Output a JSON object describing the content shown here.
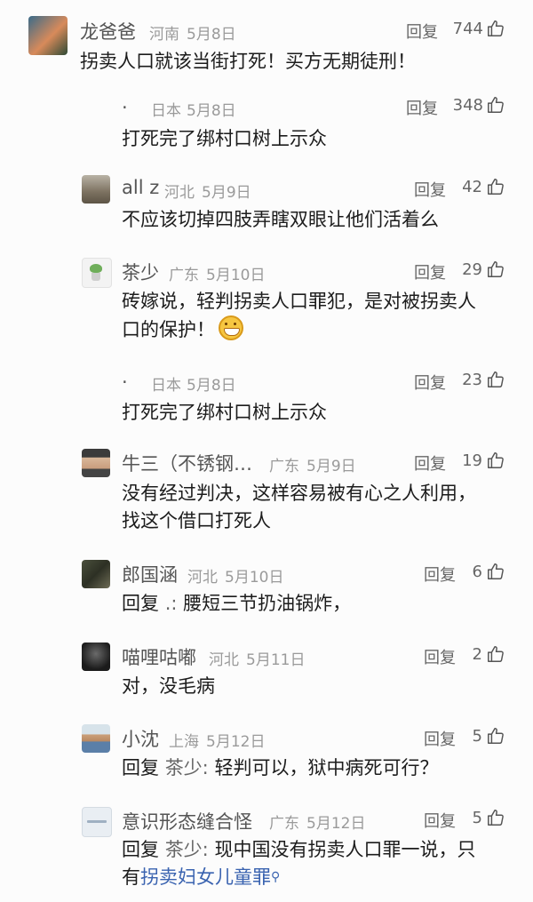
{
  "reply_label": "回复",
  "comments": [
    {
      "name": "龙爸爸",
      "location": "河南",
      "date": "5月8日",
      "likes": "744",
      "text": "拐卖人口就该当街打死！买方无期徒刑！"
    },
    {
      "name": ".",
      "location": "日本",
      "date": "5月8日",
      "likes": "348",
      "text": "打死完了绑村口树上示众"
    },
    {
      "name": "all z",
      "location": "河北",
      "date": "5月9日",
      "likes": "42",
      "text": "不应该切掉四肢弄瞎双眼让他们活着么"
    },
    {
      "name": "茶少",
      "location": "广东",
      "date": "5月10日",
      "likes": "29",
      "text_line1": "砖嫁说，轻判拐卖人口罪犯，是对被拐卖人",
      "text_line2": "口的保护！",
      "emoji": "grinning-emoji"
    },
    {
      "name": ".",
      "location": "日本",
      "date": "5月8日",
      "likes": "23",
      "text": "打死完了绑村口树上示众"
    },
    {
      "name": "牛三（不锈钢…",
      "location": "广东",
      "date": "5月9日",
      "likes": "19",
      "text_line1": "没有经过判决，这样容易被有心之人利用，",
      "text_line2": "找这个借口打死人"
    },
    {
      "name": "郎国涵",
      "location": "河北",
      "date": "5月10日",
      "likes": "6",
      "prefix": "回复",
      "mention": ".:",
      "text": "腰短三节扔油锅炸，"
    },
    {
      "name": "喵哩咕嘟",
      "location": "河北",
      "date": "5月11日",
      "likes": "2",
      "text": "对，没毛病"
    },
    {
      "name": "小沈",
      "location": "上海",
      "date": "5月12日",
      "likes": "5",
      "prefix": "回复",
      "mention": "茶少:",
      "text": "轻判可以，狱中病死可行？"
    },
    {
      "name": "意识形态缝合怪",
      "location": "广东",
      "date": "5月12日",
      "likes": "5",
      "prefix": "回复",
      "mention": "茶少:",
      "text_line1": "现中国没有拐卖人口罪一说，只",
      "text_line2_pre": "有",
      "link": "拐卖妇女儿童罪",
      "search_glyph": "⚲"
    }
  ]
}
